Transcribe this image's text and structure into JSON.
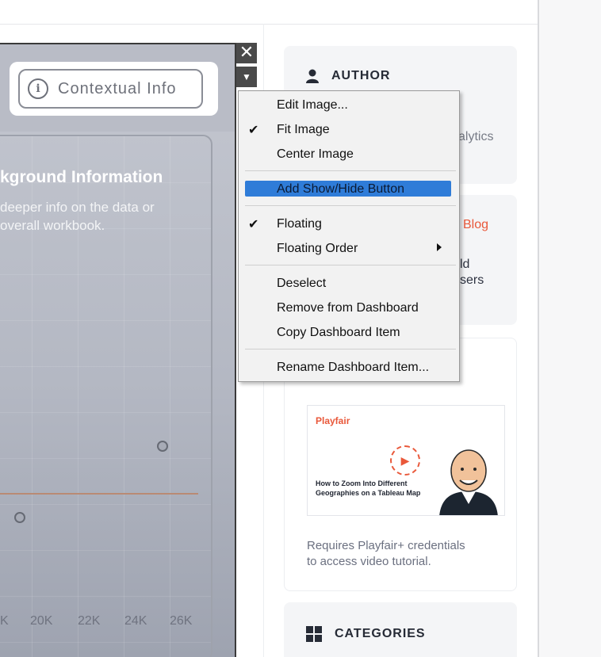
{
  "dashboard": {
    "info_button_label": "Contextual Info",
    "background_title": "kground Information",
    "background_desc_line1": "deeper info on the data or",
    "background_desc_line2": "overall workbook.",
    "x_ticks": [
      "K",
      "20K",
      "22K",
      "24K",
      "26K"
    ]
  },
  "controls": {
    "close_glyph": "✕",
    "more_glyph": "▼"
  },
  "context_menu": {
    "items": [
      {
        "label": "Edit Image...",
        "checked": false
      },
      {
        "label": "Fit Image",
        "checked": true
      },
      {
        "label": "Center Image",
        "checked": false
      },
      {
        "label": "Add Show/Hide Button",
        "checked": false,
        "highlighted": true
      },
      {
        "label": "Floating",
        "checked": true
      },
      {
        "label": "Floating Order",
        "checked": false,
        "submenu": true
      },
      {
        "label": "Deselect",
        "checked": false
      },
      {
        "label": "Remove from Dashboard",
        "checked": false
      },
      {
        "label": "Copy Dashboard Item",
        "checked": false
      },
      {
        "label": "Rename Dashboard Item...",
        "checked": false
      }
    ],
    "check_glyph": "✔"
  },
  "sidebar": {
    "author_heading": "AUTHOR",
    "author_partial": "alytics",
    "blog_partial_link": "Blog",
    "blog_partial_line1": "ld",
    "blog_partial_line2": "sers",
    "video": {
      "brand": "Playfair",
      "play_glyph": "▶",
      "title": "How to Zoom Into Different Geographies on a Tableau Map",
      "caption_line1": "Requires Playfair+ credentials",
      "caption_line2": "to access video tutorial."
    },
    "categories_heading": "CATEGORIES"
  },
  "colors": {
    "accent": "#e9583a",
    "menu_highlight": "#2f7cd8",
    "heading": "#262b36"
  }
}
